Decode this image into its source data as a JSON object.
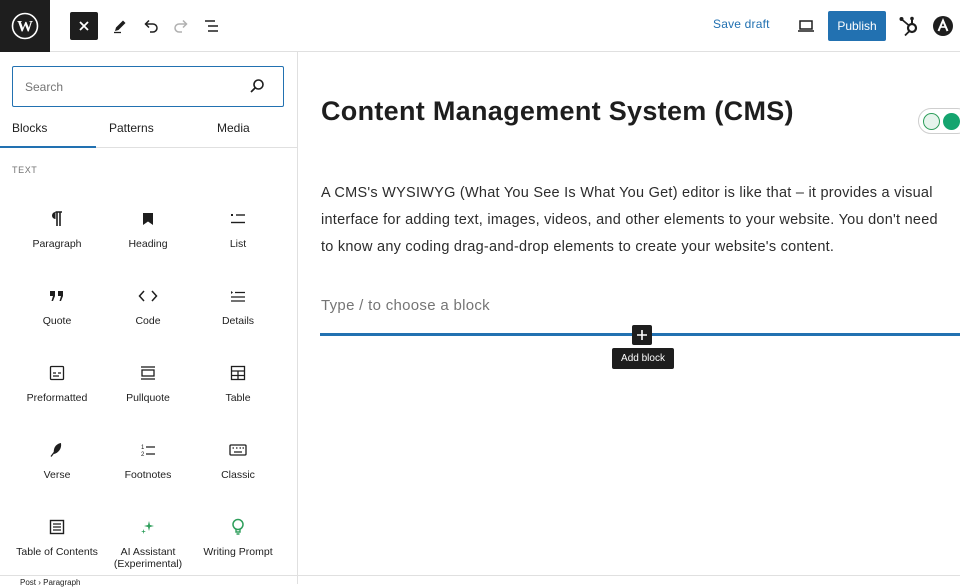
{
  "topbar": {
    "save_draft_label": "Save draft",
    "publish_label": "Publish",
    "accent_color": "#2271b1"
  },
  "inserter": {
    "search": {
      "value": "",
      "placeholder": "Search"
    },
    "tabs": [
      {
        "label": "Blocks",
        "active": true
      },
      {
        "label": "Patterns",
        "active": false
      },
      {
        "label": "Media",
        "active": false
      }
    ],
    "section_label": "TEXT",
    "blocks": [
      {
        "label": "Paragraph",
        "icon": "paragraph-icon"
      },
      {
        "label": "Heading",
        "icon": "bookmark-icon"
      },
      {
        "label": "List",
        "icon": "list-icon"
      },
      {
        "label": "Quote",
        "icon": "quote-icon"
      },
      {
        "label": "Code",
        "icon": "code-icon"
      },
      {
        "label": "Details",
        "icon": "details-icon"
      },
      {
        "label": "Preformatted",
        "icon": "preformatted-icon"
      },
      {
        "label": "Pullquote",
        "icon": "pullquote-icon"
      },
      {
        "label": "Table",
        "icon": "table-icon"
      },
      {
        "label": "Verse",
        "icon": "feather-icon"
      },
      {
        "label": "Footnotes",
        "icon": "footnotes-icon"
      },
      {
        "label": "Classic",
        "icon": "keyboard-icon"
      },
      {
        "label": "Table of Contents",
        "icon": "table-of-contents-icon"
      },
      {
        "label": "AI Assistant (Experimental)",
        "icon": "sparkles-icon"
      },
      {
        "label": "Writing Prompt",
        "icon": "lightbulb-icon"
      }
    ]
  },
  "editor": {
    "title": "Content Management System (CMS)",
    "paragraph_lines": [
      "A CMS's WYSIWYG (What You See Is What You Get) editor is like that – it provides a visual",
      "interface for adding text, images, videos, and other elements to your website. You don't need",
      "to know any coding drag-and-drop elements to create your website's content."
    ],
    "placeholder": "Type / to choose a block",
    "add_block_tooltip": "Add block"
  },
  "footer": {
    "breadcrumb": "Post  ›  Paragraph"
  }
}
